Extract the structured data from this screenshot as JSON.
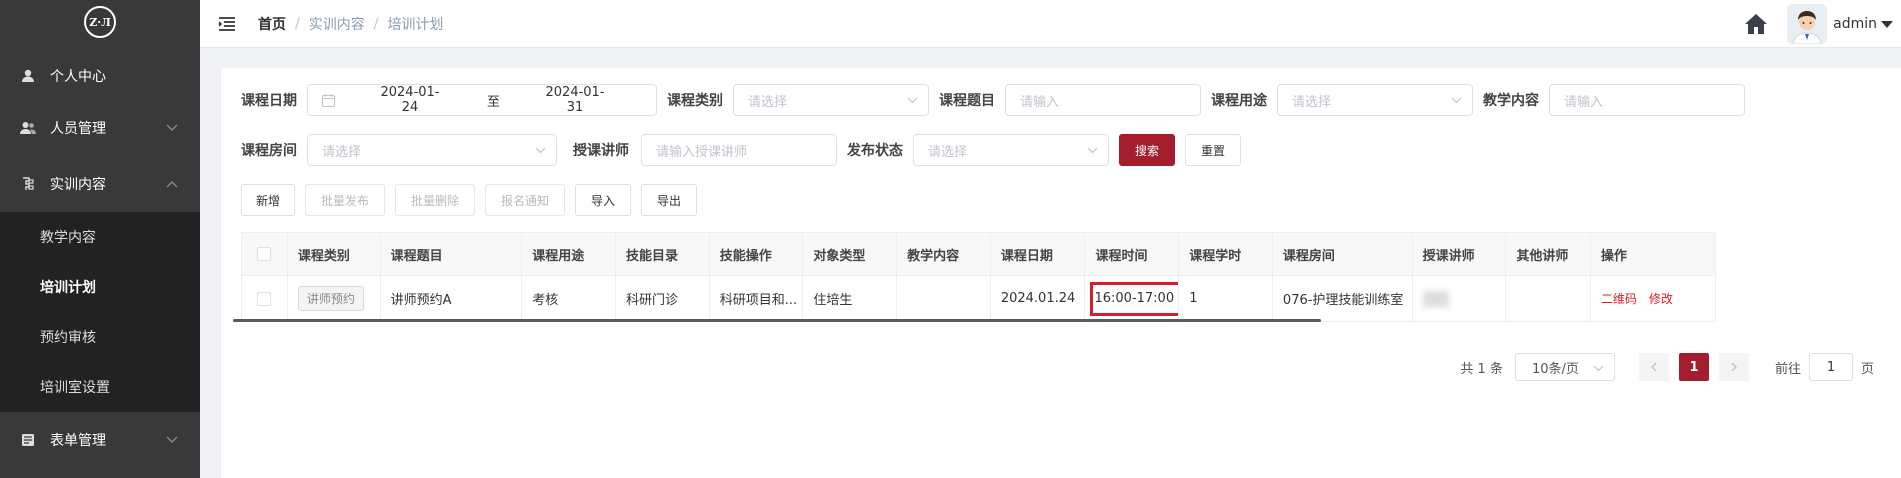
{
  "sidebar": {
    "logo_text": "Z·Л",
    "items": [
      {
        "label": "个人中心",
        "icon": "user-icon"
      },
      {
        "label": "人员管理",
        "icon": "users-icon"
      },
      {
        "label": "实训内容",
        "icon": "training-icon"
      },
      {
        "label": "表单管理",
        "icon": "form-icon"
      }
    ],
    "submenu": [
      {
        "label": "教学内容"
      },
      {
        "label": "培训计划",
        "active": true
      },
      {
        "label": "预约审核"
      },
      {
        "label": "培训室设置"
      }
    ]
  },
  "header": {
    "breadcrumb": [
      "首页",
      "实训内容",
      "培训计划"
    ],
    "username": "admin"
  },
  "filters": {
    "course_date_label": "课程日期",
    "date_start": "2024-01-24",
    "date_to": "至",
    "date_end": "2024-01-31",
    "course_type_label": "课程类别",
    "course_type_placeholder": "请选择",
    "course_topic_label": "课程题目",
    "course_topic_placeholder": "请输入",
    "course_use_label": "课程用途",
    "course_use_placeholder": "请选择",
    "teaching_content_label": "教学内容",
    "teaching_content_placeholder": "请输入",
    "room_label": "课程房间",
    "room_placeholder": "请选择",
    "lecturer_label": "授课讲师",
    "lecturer_placeholder": "请输入授课讲师",
    "publish_label": "发布状态",
    "publish_placeholder": "请选择",
    "search_label": "搜索",
    "reset_label": "重置"
  },
  "toolbar": {
    "add": "新增",
    "batch_publish": "批量发布",
    "batch_delete": "批量删除",
    "notify": "报名通知",
    "import": "导入",
    "export": "导出"
  },
  "table": {
    "columns": [
      "课程类别",
      "课程题目",
      "课程用途",
      "技能目录",
      "技能操作",
      "对象类型",
      "教学内容",
      "课程日期",
      "课程时间",
      "课程学时",
      "课程房间",
      "授课讲师",
      "其他讲师",
      "操作"
    ],
    "rows": [
      {
        "course_type": "讲师预约",
        "topic": "讲师预约A",
        "use": "考核",
        "skill_dir": "科研门诊",
        "skill_op": "科研项目和...",
        "target": "住培生",
        "content": "",
        "date": "2024.01.24",
        "time": "16:00-17:00",
        "hours": "1",
        "room": "076-护理技能训练室",
        "lecturer": "",
        "other": "",
        "op_qr": "二维码",
        "op_edit": "修改"
      }
    ]
  },
  "pagination": {
    "total": "共 1 条",
    "page_size": "10条/页",
    "current": "1",
    "goto_prefix": "前往",
    "goto_value": "1",
    "goto_suffix": "页"
  },
  "colors": {
    "accent": "#a31d2d",
    "sidebar": "#393939",
    "highlight": "#d81e2a"
  }
}
